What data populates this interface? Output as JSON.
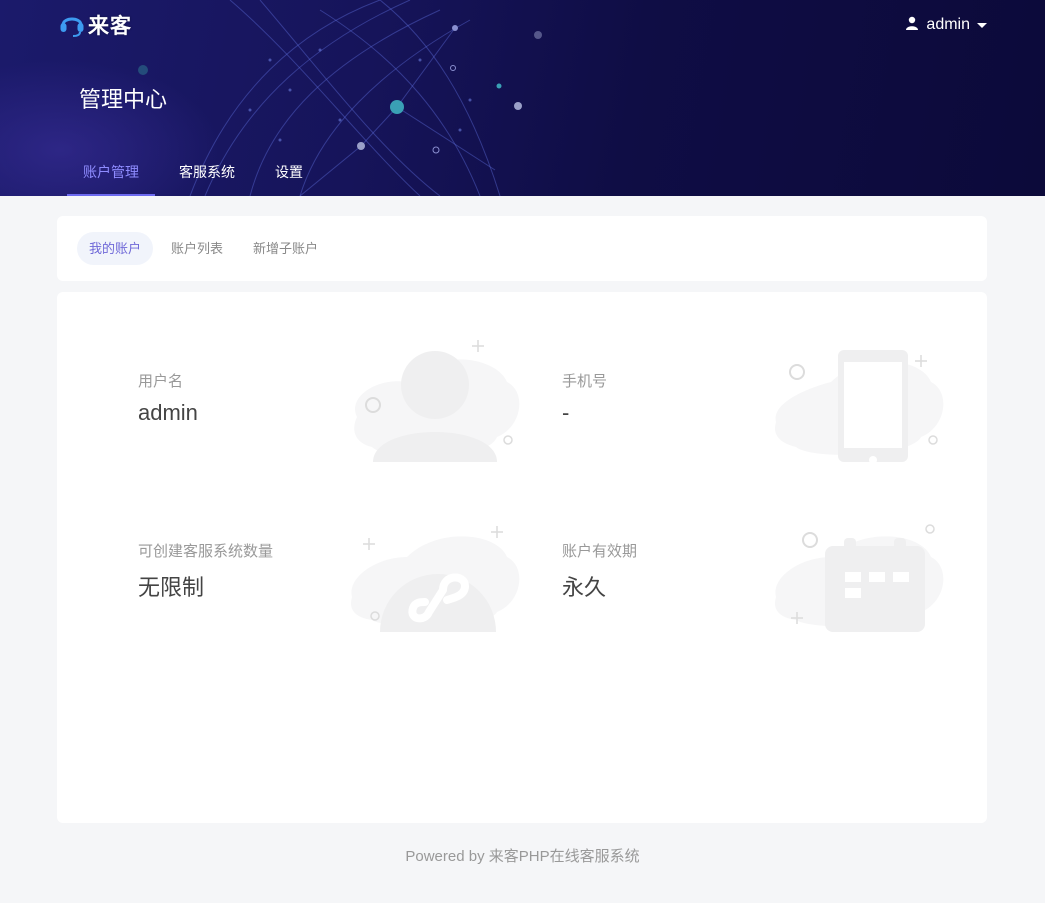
{
  "brand": {
    "name": "来客",
    "logo_icon": "headset-icon"
  },
  "user": {
    "name": "admin",
    "icon": "user-icon"
  },
  "page_title": "管理中心",
  "top_nav": [
    {
      "label": "账户管理",
      "active": true
    },
    {
      "label": "客服系统",
      "active": false
    },
    {
      "label": "设置",
      "active": false
    }
  ],
  "sub_tabs": [
    {
      "label": "我的账户",
      "active": true
    },
    {
      "label": "账户列表",
      "active": false
    },
    {
      "label": "新增子账户",
      "active": false
    }
  ],
  "account_info": [
    {
      "label": "用户名",
      "value": "admin",
      "icon": "user-illustration"
    },
    {
      "label": "手机号",
      "value": "-",
      "icon": "phone-illustration"
    },
    {
      "label": "可创建客服系统数量",
      "value": "无限制",
      "icon": "mini-program-illustration"
    },
    {
      "label": "账户有效期",
      "value": "永久",
      "icon": "calendar-illustration"
    }
  ],
  "footer": "Powered by 来客PHP在线客服系统",
  "colors": {
    "header_bg": "#16145a",
    "accent": "#6d6af0",
    "page_bg": "#f5f6f8"
  }
}
